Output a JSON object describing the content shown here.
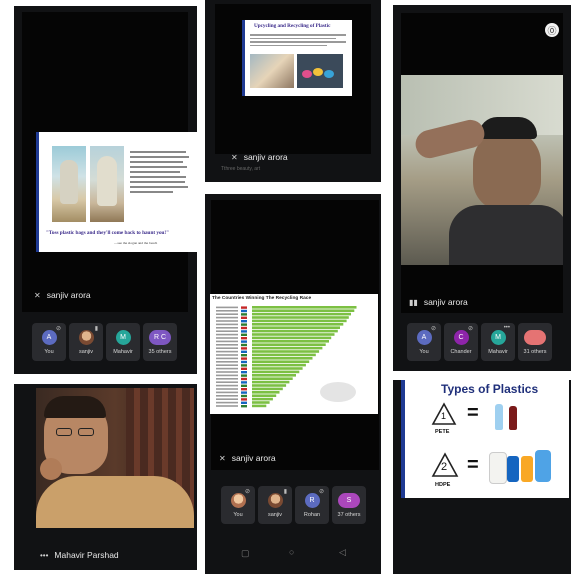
{
  "colors": {
    "bg": "#050505",
    "tile": "#2a2b2f",
    "slideBlue": "#1f3a93",
    "bar": "#7cc043",
    "title": "#3a2a8a"
  },
  "panel1": {
    "speaker": "sanjiv arora",
    "quote": "\"Toss plastic bags and they'll come back to haunt you!\"",
    "quote_attr": "—see the slogan and the beach",
    "participants": [
      {
        "name": "You",
        "initial": "A",
        "color": "#5c6bc0"
      },
      {
        "name": "sanjiv",
        "initial": "",
        "color": "#9c6b4f"
      },
      {
        "name": "Mahavir",
        "initial": "M",
        "color": "#26a69a"
      },
      {
        "name": "35 others",
        "initial": "R C",
        "color": "#7e57c2"
      }
    ]
  },
  "panel2": {
    "slide_title": "Upcycling and Recycling of Plastic",
    "speaker": "sanjiv arora",
    "sub": "Tthree beauty, art"
  },
  "panel3": {
    "speaker": "sanjiv arora",
    "participants": [
      {
        "name": "You",
        "initial": "A",
        "color": "#5c6bc0"
      },
      {
        "name": "Chander",
        "initial": "C",
        "color": "#8e24aa"
      },
      {
        "name": "Mahavir",
        "initial": "M",
        "color": "#26a69a"
      },
      {
        "name": "31 others",
        "initial": "",
        "color": "#e57373"
      }
    ]
  },
  "panel4": {
    "slide_title": "The Countries Winning The Recycling Race",
    "speaker": "sanjiv arora",
    "participants": [
      {
        "name": "You",
        "initial": "",
        "color": "#e0a070"
      },
      {
        "name": "sanjiv",
        "initial": "",
        "color": "#9c6b4f"
      },
      {
        "name": "Rohan",
        "initial": "R",
        "color": "#5c6bc0"
      },
      {
        "name": "37 others",
        "initial": "S",
        "color": "#ab47bc"
      }
    ]
  },
  "panel5": {
    "speaker": "Mahavir Parshad"
  },
  "panel6": {
    "title": "Types of Plastics",
    "items": [
      {
        "num": "1",
        "label": "PETE"
      },
      {
        "num": "2",
        "label": "HDPE"
      }
    ],
    "eq": "="
  },
  "chart_data": {
    "type": "bar",
    "title": "The Countries Winning The Recycling Race",
    "values": [
      0.95,
      0.93,
      0.9,
      0.88,
      0.86,
      0.83,
      0.8,
      0.78,
      0.75,
      0.72,
      0.7,
      0.67,
      0.64,
      0.61,
      0.58,
      0.55,
      0.52,
      0.49,
      0.46,
      0.43,
      0.4,
      0.37,
      0.34,
      0.31,
      0.28,
      0.25,
      0.22,
      0.19,
      0.16,
      0.13
    ]
  }
}
